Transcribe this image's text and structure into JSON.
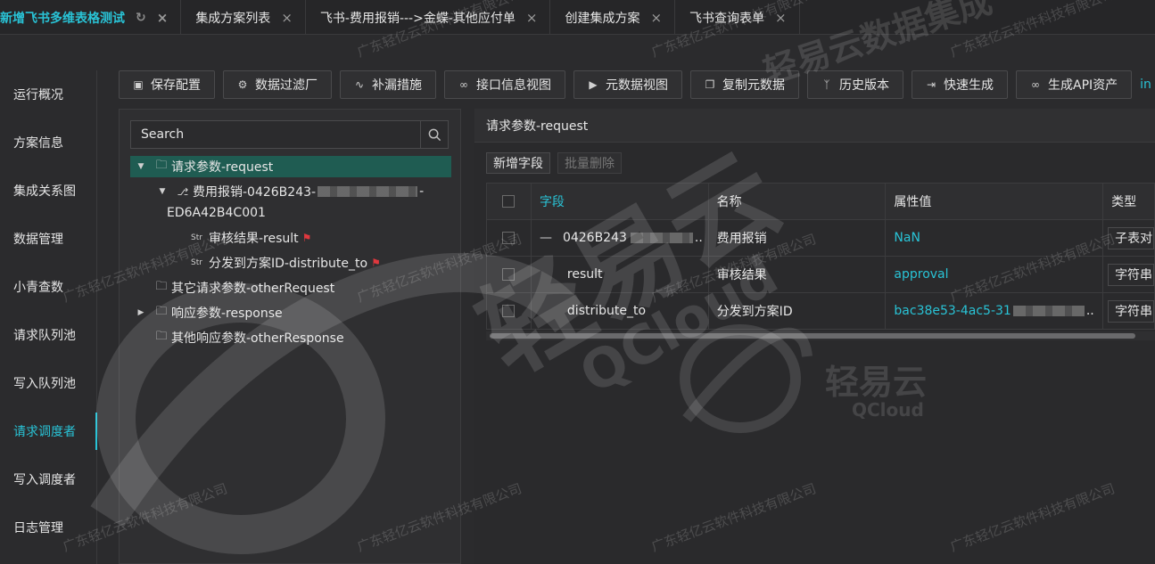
{
  "tabs": [
    {
      "label": "新增飞书多维表格测试",
      "active": true,
      "refresh": true
    },
    {
      "label": "集成方案列表",
      "active": false
    },
    {
      "label": "飞书-费用报销--->金蝶-其他应付单",
      "active": false
    },
    {
      "label": "创建集成方案",
      "active": false
    },
    {
      "label": "飞书查询表单",
      "active": false
    }
  ],
  "sidebar": {
    "items": [
      {
        "label": "运行概况"
      },
      {
        "label": "方案信息"
      },
      {
        "label": "集成关系图"
      },
      {
        "label": "数据管理"
      },
      {
        "label": "小青查数"
      },
      {
        "label": "请求队列池"
      },
      {
        "label": "写入队列池"
      },
      {
        "label": "请求调度者",
        "active": true
      },
      {
        "label": "写入调度者"
      },
      {
        "label": "日志管理"
      }
    ]
  },
  "toolbar": {
    "buttons": [
      {
        "label": "保存配置",
        "icon": "save-icon"
      },
      {
        "label": "数据过滤厂",
        "icon": "gear-icon"
      },
      {
        "label": "补漏措施",
        "icon": "trend-icon"
      },
      {
        "label": "接口信息视图",
        "icon": "link-icon"
      },
      {
        "label": "元数据视图",
        "icon": "terminal-icon"
      },
      {
        "label": "复制元数据",
        "icon": "copy-icon"
      },
      {
        "label": "历史版本",
        "icon": "branch-icon"
      },
      {
        "label": "快速生成",
        "icon": "export-icon"
      },
      {
        "label": "生成API资产",
        "icon": "link-icon"
      }
    ],
    "overflow_text": "in"
  },
  "tree": {
    "search_placeholder": "Search",
    "nodes": [
      {
        "label": "请求参数-request",
        "level": 0,
        "expanded": true,
        "selected": true,
        "icon": "folder-icon"
      },
      {
        "label_prefix": "费用报销-0426B243-",
        "label_suffix": "-",
        "label_line2": "ED6A42B4C001",
        "level": 1,
        "expanded": true,
        "icon": "hierarchy-icon"
      },
      {
        "label": "审核结果-result",
        "level": 2,
        "icon": "string-icon",
        "flag": true
      },
      {
        "label": "分发到方案ID-distribute_to",
        "level": 2,
        "icon": "string-icon",
        "flag": true
      },
      {
        "label": "其它请求参数-otherRequest",
        "level": 0,
        "icon": "folder-icon"
      },
      {
        "label": "响应参数-response",
        "level": 0,
        "collapsed": true,
        "icon": "folder-icon"
      },
      {
        "label": "其他响应参数-otherResponse",
        "level": 0,
        "icon": "folder-icon"
      }
    ]
  },
  "detail": {
    "title": "请求参数-request",
    "add_field_label": "新增字段",
    "batch_delete_label": "批量删除",
    "columns": [
      "字段",
      "名称",
      "属性值",
      "类型"
    ],
    "rows": [
      {
        "field": "0426B243",
        "name": "费用报销",
        "value": "NaN",
        "type": "子表对"
      },
      {
        "field": "result",
        "name": "审核结果",
        "value": "approval",
        "type": "字符串"
      },
      {
        "field": "distribute_to",
        "name": "分发到方案ID",
        "value": "bac38e53-4ac5-31",
        "type": "字符串"
      }
    ]
  },
  "watermark": {
    "company": "广东轻亿云软件科技有限公司",
    "brand_cn": "轻易云",
    "brand_en": "QCloud",
    "partial_title": "轻易云数据集成"
  },
  "colors": {
    "accent": "#29c3d6",
    "selected": "#1f5c52",
    "flag": "#e0383e"
  }
}
